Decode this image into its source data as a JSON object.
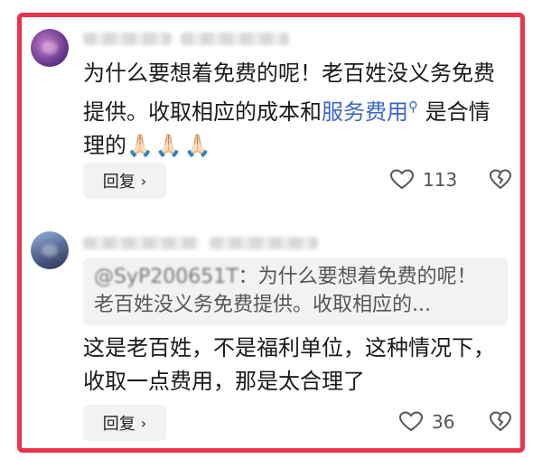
{
  "comments": [
    {
      "text_part1": "为什么要想着免费的呢！老百姓没义务免费提供。收取相应的成本和",
      "link_text": "服务费用",
      "search_glyph": "⚲",
      "text_part2": " 是合情理的",
      "emoji_reactions": "🙏🏻🙏🏻🙏🏻",
      "reply_label": "回复",
      "reply_chevron": "›",
      "like_count": "113"
    },
    {
      "quote_handle": "@SyP200651T",
      "quote_text": "：为什么要想着免费的呢！",
      "quote_line2": "老百姓没义务免费提供。收取相应的...",
      "text": "这是老百姓，不是福利单位，这种情况下，收取一点费用，那是太合理了",
      "reply_label": "回复",
      "reply_chevron": "›",
      "like_count": "36"
    }
  ],
  "colors": {
    "highlight_border": "#e8344a",
    "link": "#3a66c7",
    "reply_bg": "#f2f2f2"
  },
  "icons": [
    "heart-icon",
    "dislike-icon",
    "search-icon",
    "chevron-right-icon"
  ]
}
